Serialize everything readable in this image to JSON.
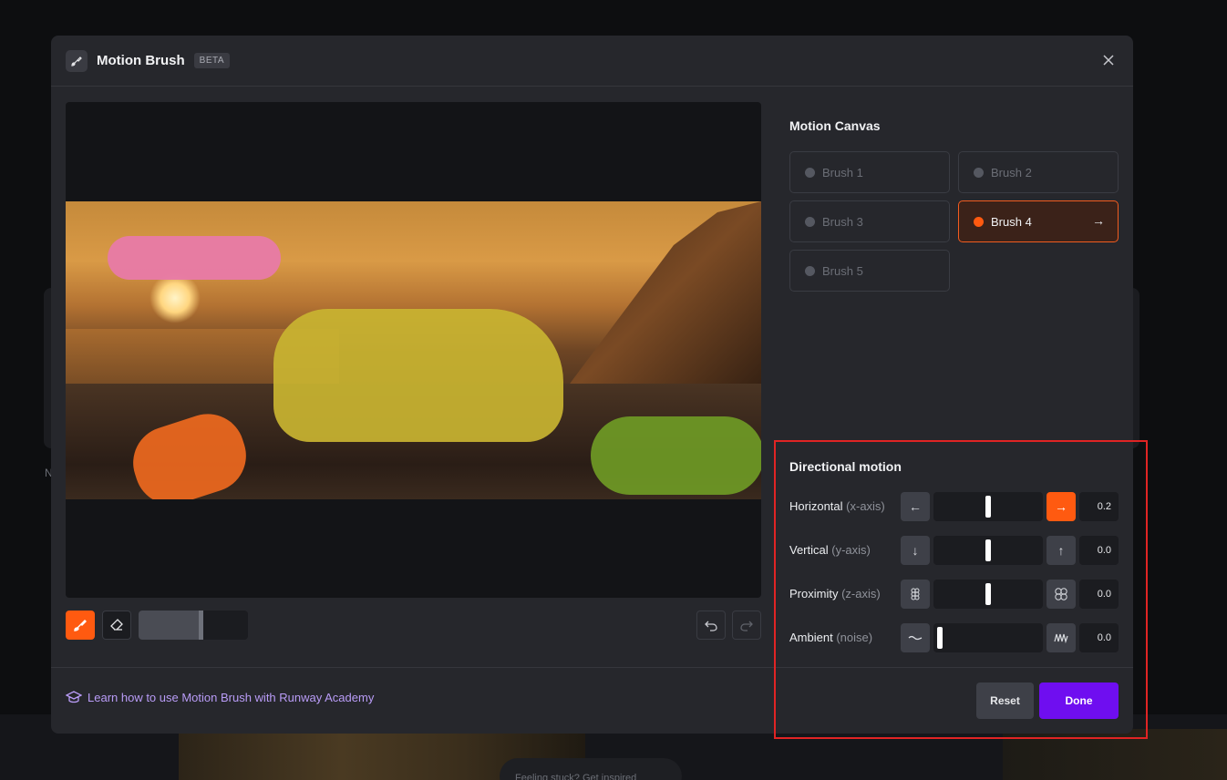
{
  "background": {
    "hint_text": "Feeling stuck? Get inspired",
    "side_letter": "N"
  },
  "modal": {
    "title": "Motion Brush",
    "badge": "BETA",
    "close_icon": "close-icon"
  },
  "canvas": {
    "brush_tool": "paint-brush-icon",
    "eraser_tool": "eraser-icon",
    "brush_size": 0.55,
    "undo_icon": "undo-icon",
    "redo_icon": "redo-icon"
  },
  "learn_link": "Learn how to use Motion Brush with Runway Academy",
  "motion_canvas": {
    "title": "Motion Canvas",
    "brushes": [
      {
        "label": "Brush 1",
        "active": false
      },
      {
        "label": "Brush 2",
        "active": false
      },
      {
        "label": "Brush 3",
        "active": false
      },
      {
        "label": "Brush 4",
        "active": true
      },
      {
        "label": "Brush 5",
        "active": false
      }
    ]
  },
  "directional_motion": {
    "title": "Directional motion",
    "rows": [
      {
        "label": "Horizontal",
        "sub": "(x-axis)",
        "value": "0.2",
        "level": 0.5
      },
      {
        "label": "Vertical",
        "sub": "(y-axis)",
        "value": "0.0",
        "level": 0.5
      },
      {
        "label": "Proximity",
        "sub": "(z-axis)",
        "value": "0.0",
        "level": 0.5
      },
      {
        "label": "Ambient",
        "sub": "(noise)",
        "value": "0.0",
        "level": 0.0
      }
    ]
  },
  "actions": {
    "reset": "Reset",
    "done": "Done"
  },
  "colors": {
    "accent_orange": "#ff5a10",
    "accent_purple": "#6f0ef0",
    "highlight_border": "#e02424"
  }
}
